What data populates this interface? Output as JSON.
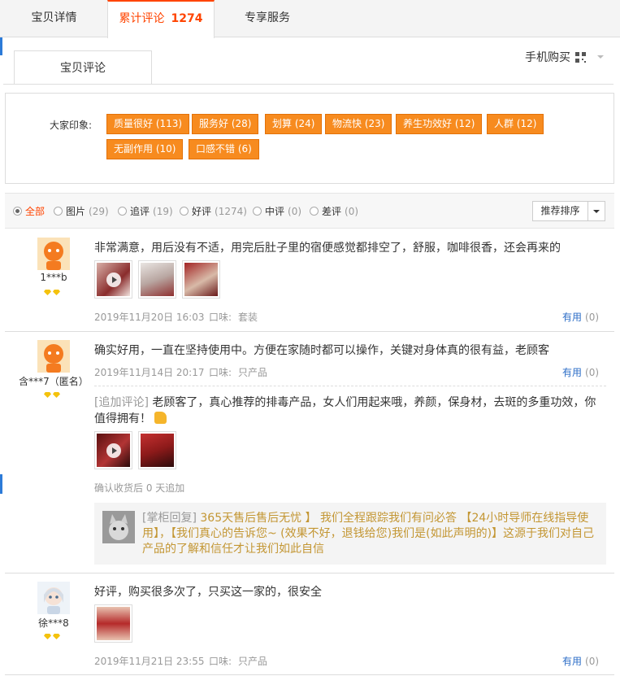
{
  "tabs": [
    {
      "label": "宝贝详情"
    },
    {
      "label": "累计评论",
      "count": "1274"
    },
    {
      "label": "专享服务"
    }
  ],
  "subtab": "宝贝评论",
  "mobile_buy": "手机购买",
  "impression": {
    "label": "大家印象:",
    "tags": [
      "质量很好 (113)",
      "服务好 (28)",
      "划算 (24)",
      "物流快 (23)",
      "养生功效好 (12)",
      "人群 (12)",
      "无副作用 (10)",
      "口感不错 (6)"
    ]
  },
  "filter": {
    "options": [
      {
        "label": "全部",
        "count": ""
      },
      {
        "label": "图片",
        "count": "(29)"
      },
      {
        "label": "追评",
        "count": "(19)"
      },
      {
        "label": "好评",
        "count": "(1274)"
      },
      {
        "label": "中评",
        "count": "(0)"
      },
      {
        "label": "差评",
        "count": "(0)"
      }
    ],
    "sort_label": "推荐排序"
  },
  "reviews": [
    {
      "user": "1***b",
      "text": "非常满意，用后没有不适，用完后肚子里的宿便感觉都排空了，舒服，咖啡很香，还会再来的",
      "date": "2019年11月20日 16:03",
      "taste_label": "口味:",
      "taste": "套装",
      "useful": "有用",
      "useful_count": "(0)"
    },
    {
      "user": "含***7（匿名）",
      "text": "确实好用，一直在坚持使用中。方便在家随时都可以操作，关键对身体真的很有益，老顾客",
      "date": "2019年11月14日 20:17",
      "taste_label": "口味:",
      "taste": "只产品",
      "useful": "有用",
      "useful_count": "(0)",
      "append_label": "[追加评论]",
      "append_line1": "老顾客了，真心推荐的排毒产品，女人们用起来哦，养颜，保身材，去斑的多重功效，你",
      "append_line2": "值得拥有！",
      "append_meta": "确认收货后 0 天追加",
      "reply_label": "[掌柜回复]",
      "reply_text": "365天售后售后无忧 】 我们全程跟踪我们有问必答 【24小时导师在线指导使用】，【我们真心的告诉您~ (效果不好，退钱给您)我们是(如此声明的)】这源于我们对自己产品的了解和信任才让我们如此自信"
    },
    {
      "user": "徐***8",
      "text": "好评，购买很多次了，只买这一家的，很安全",
      "date": "2019年11月21日 23:55",
      "taste_label": "口味:",
      "taste": "只产品",
      "useful": "有用",
      "useful_count": "(0)"
    }
  ],
  "colors": {
    "accent": "#ff4400",
    "tag_bg": "#f78b1f",
    "link": "#2d6ec7",
    "reply": "#c39633"
  }
}
